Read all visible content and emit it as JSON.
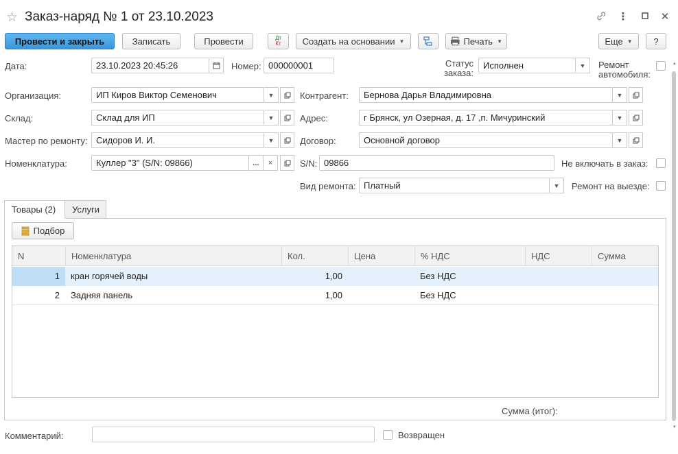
{
  "window": {
    "title": "Заказ-наряд № 1 от 23.10.2023",
    "star": "☆",
    "link_icon": "⛓",
    "more_icon": "⋮",
    "max_icon": "☐",
    "close_icon": "✕"
  },
  "toolbar": {
    "post_close": "Провести и закрыть",
    "save": "Записать",
    "post": "Провести",
    "dt_kt_top": "Дт",
    "dt_kt_bottom": "Кт",
    "create_based": "Создать на основании",
    "print": "Печать",
    "more": "Еще",
    "help": "?"
  },
  "form": {
    "date_label": "Дата:",
    "date_value": "23.10.2023 20:45:26",
    "number_label": "Номер:",
    "number_value": "000000001",
    "status_label_1": "Статус",
    "status_label_2": "заказа:",
    "status_value": "Исполнен",
    "car_repair_label_1": "Ремонт",
    "car_repair_label_2": "автомобиля:",
    "org_label": "Организация:",
    "org_value": "ИП Киров Виктор Семенович",
    "counterparty_label": "Контрагент:",
    "counterparty_value": "Бернова Дарья Владимировна",
    "warehouse_label": "Склад:",
    "warehouse_value": "Склад для ИП",
    "address_label": "Адрес:",
    "address_value": "г Брянск, ул Озерная, д. 17 ,п. Мичуринский",
    "master_label": "Мастер по ремонту:",
    "master_value": "Сидоров И. И.",
    "contract_label": "Договор:",
    "contract_value": "Основной договор",
    "nomenclature_label": "Номенклатура:",
    "nomenclature_value": "Куллер \"3\" (S/N: 09866)",
    "sn_label": "S/N:",
    "sn_value": "09866",
    "exclude_label": "Не включать в заказ:",
    "repair_type_label": "Вид ремонта:",
    "repair_type_value": "Платный",
    "onsite_label": "Ремонт на выезде:"
  },
  "tabs": [
    {
      "label": "Товары (2)"
    },
    {
      "label": "Услуги"
    }
  ],
  "goods": {
    "pick_button": "Подбор",
    "columns": [
      "N",
      "Номенклатура",
      "Кол.",
      "Цена",
      "% НДС",
      "НДС",
      "Сумма"
    ],
    "rows": [
      {
        "n": "1",
        "name": "кран горячей воды",
        "qty": "1,00",
        "price": "",
        "vat_rate": "Без НДС",
        "vat": "",
        "sum": ""
      },
      {
        "n": "2",
        "name": "Задняя панель",
        "qty": "1,00",
        "price": "",
        "vat_rate": "Без НДС",
        "vat": "",
        "sum": ""
      }
    ],
    "total_label": "Сумма (итог):"
  },
  "footer": {
    "comment_label": "Комментарий:",
    "comment_value": "",
    "returned_label": "Возвращен"
  },
  "colors": {
    "primary_button": "#3a97dc",
    "selected_row": "#e4f0fb"
  }
}
